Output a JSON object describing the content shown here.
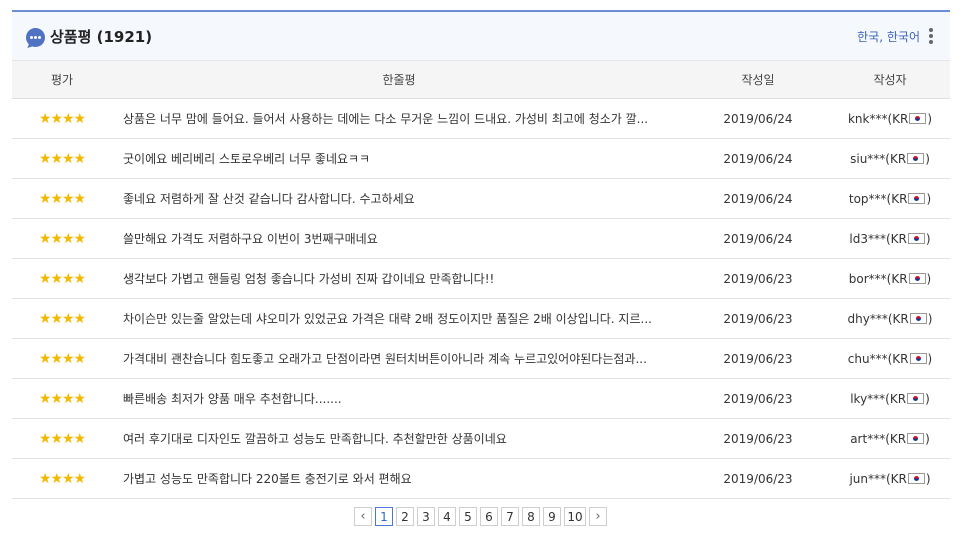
{
  "header": {
    "title": "상품평 (1921)",
    "language": "한국, 한국어",
    "icon": "chat-bubble-icon"
  },
  "columns": [
    "평가",
    "한줄평",
    "작성일",
    "작성자"
  ],
  "reviews": [
    {
      "stars": "★★★★",
      "text": "상품은 너무 맘에 들어요. 들어서 사용하는 데에는 다소 무거운 느낌이 드내요. 가성비 최고에 청소가 깔...",
      "date": "2019/06/24",
      "author_prefix": "knk***(KR",
      "author_suffix": ")"
    },
    {
      "stars": "★★★★",
      "text": "굿이에요 베리베리 스토로우베리 너무 좋네요ㅋㅋ",
      "date": "2019/06/24",
      "author_prefix": "siu***(KR",
      "author_suffix": ")"
    },
    {
      "stars": "★★★★",
      "text": "좋네요 저렴하게 잘 산것 같습니다 감사합니다. 수고하세요",
      "date": "2019/06/24",
      "author_prefix": "top***(KR",
      "author_suffix": ")"
    },
    {
      "stars": "★★★★",
      "text": "쓸만해요 가격도 저렴하구요 이번이 3번째구매네요",
      "date": "2019/06/24",
      "author_prefix": "ld3***(KR",
      "author_suffix": ")"
    },
    {
      "stars": "★★★★",
      "text": "생각보다 가볍고 핸들링 엄청 좋습니다 가성비 진짜 갑이네요 만족합니다!!",
      "date": "2019/06/23",
      "author_prefix": "bor***(KR",
      "author_suffix": ")"
    },
    {
      "stars": "★★★★",
      "text": "차이슨만 있는줄 알았는데 샤오미가 있었군요 가격은 대략 2배 정도이지만 품질은 2배 이상입니다. 지르...",
      "date": "2019/06/23",
      "author_prefix": "dhy***(KR",
      "author_suffix": ")"
    },
    {
      "stars": "★★★★",
      "text": "가격대비 괜찬습니다 힘도좋고 오래가고 단점이라면 원터치버튼이아니라 계속 누르고있어야된다는점과...",
      "date": "2019/06/23",
      "author_prefix": "chu***(KR",
      "author_suffix": ")"
    },
    {
      "stars": "★★★★",
      "text": "빠른배송 최저가 양품 매우 추천합니다.......",
      "date": "2019/06/23",
      "author_prefix": "lky***(KR",
      "author_suffix": ")"
    },
    {
      "stars": "★★★★",
      "text": "여러 후기대로 디자인도 깔끔하고 성능도 만족합니다. 추천할만한 상품이네요",
      "date": "2019/06/23",
      "author_prefix": "art***(KR",
      "author_suffix": ")"
    },
    {
      "stars": "★★★★",
      "text": "가볍고 성능도 만족합니다 220볼트 충전기로 와서 편해요",
      "date": "2019/06/23",
      "author_prefix": "jun***(KR",
      "author_suffix": ")"
    }
  ],
  "pagination": {
    "prev": "‹",
    "next": "›",
    "pages": [
      "1",
      "2",
      "3",
      "4",
      "5",
      "6",
      "7",
      "8",
      "9",
      "10"
    ],
    "current": "1"
  },
  "colors": {
    "accent": "#4f72c2",
    "star": "#f5b800",
    "link": "#3b63b8"
  }
}
